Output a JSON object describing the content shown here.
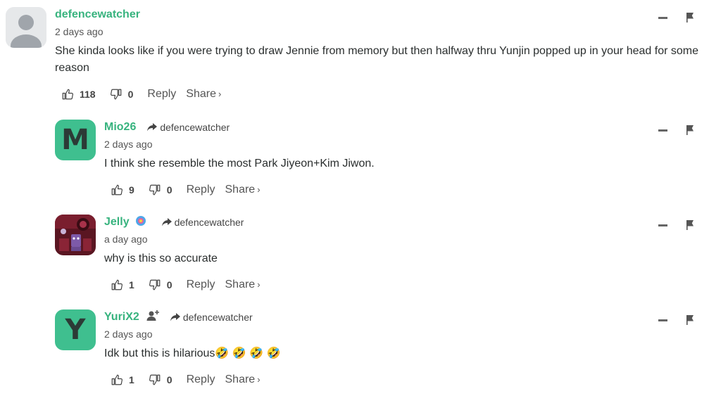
{
  "comments": [
    {
      "username": "defencewatcher",
      "reply_to": "",
      "timestamp": "2 days ago",
      "text": "She kinda looks like if you were trying to draw Jennie from memory but then halfway thru Yunjin popped up in your head for some reason",
      "upvotes": "118",
      "downvotes": "0",
      "avatar_type": "default",
      "avatar_letter": ""
    },
    {
      "username": "Mio26",
      "reply_to": "defencewatcher",
      "timestamp": "2 days ago",
      "text": "I think she resemble the most Park Jiyeon+Kim Jiwon.",
      "upvotes": "9",
      "downvotes": "0",
      "avatar_type": "letter",
      "avatar_letter": "M"
    },
    {
      "username": "Jelly",
      "reply_to": "defencewatcher",
      "timestamp": "a day ago",
      "text": "why is this so accurate",
      "upvotes": "1",
      "downvotes": "0",
      "avatar_type": "image",
      "avatar_letter": ""
    },
    {
      "username": "YuriX2",
      "reply_to": "defencewatcher",
      "timestamp": "2 days ago",
      "text": "Idk but this is hilarious🤣 🤣 🤣 🤣",
      "upvotes": "1",
      "downvotes": "0",
      "avatar_type": "letter",
      "avatar_letter": "Y"
    }
  ],
  "labels": {
    "reply": "Reply",
    "share": "Share",
    "share_chevron": "›"
  },
  "icons": {
    "upvote": "thumbs-up-icon",
    "downvote": "thumbs-down-icon",
    "minimize": "minimize-icon",
    "flag": "flag-icon",
    "reply_arrow": "reply-arrow-icon"
  },
  "colors": {
    "username": "#37b37e",
    "avatar_bg": "#3fbf8f"
  }
}
